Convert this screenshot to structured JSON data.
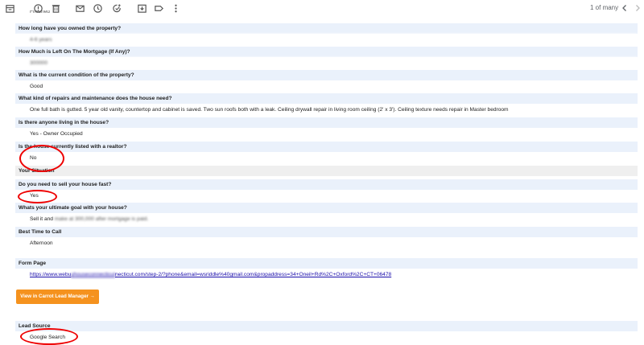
{
  "toolbar": {
    "icons": [
      "archive-icon",
      "report-spam-icon",
      "delete-icon",
      "mark-unread-icon",
      "snooze-icon",
      "add-task-icon",
      "move-to-icon",
      "label-icon",
      "more-icon"
    ],
    "pager": "1 of many"
  },
  "top_cut": "Finished",
  "rows": [
    {
      "q": "How long have you owned the property?",
      "a": "4-6 years"
    },
    {
      "q": "How Much is Left On The Mortgage (If Any)?",
      "a": "300000"
    },
    {
      "q": "What is the current condition of the property?",
      "a": "Good"
    },
    {
      "q": "What kind of repairs and maintenance does the house need?",
      "a": "One full bath is gutted. 5 year old vanity, countertop and cabinet is saved. Two sun roofs both with a leak. Ceiling drywall repair in living room ceiling (2' x 3'). Ceiling texture needs repair in Master bedroom"
    },
    {
      "q": "Is there anyone living in the house?",
      "a": "Yes - Owner Occupied"
    },
    {
      "q": "Is the house currently listed with a realtor?",
      "a": "No"
    }
  ],
  "section_title": "Your Situation",
  "situation_rows": [
    {
      "q": "Do you need to sell your house fast?",
      "a": "Yes"
    },
    {
      "q": "Whats your ultimate goal with your house?",
      "a_prefix": "Sell it and ",
      "a_blur": "make at 300,000 after mortgage is paid.",
      "a": "Sell it and make at 300,000 after mortgage is paid."
    },
    {
      "q": "Best Time to Call",
      "a": "Afternoon"
    }
  ],
  "form_page": {
    "label": "Form Page",
    "url_start": "https://www.webu",
    "url_blur": "yhouseconnecticut",
    "url_end": "necticut.com/step-2/?phone&email=wsriddle%40gmail.com&propaddress=34+Oneil+Rd%2C+Oxford%2C+CT+06478"
  },
  "cta_label": "View in Carrot Lead Manager →",
  "lead_source": {
    "label": "Lead Source",
    "value": "Google Search"
  },
  "colors": {
    "accent": "#f5921e",
    "question_bg": "#eaf1fb",
    "highlight": "#e00000"
  }
}
